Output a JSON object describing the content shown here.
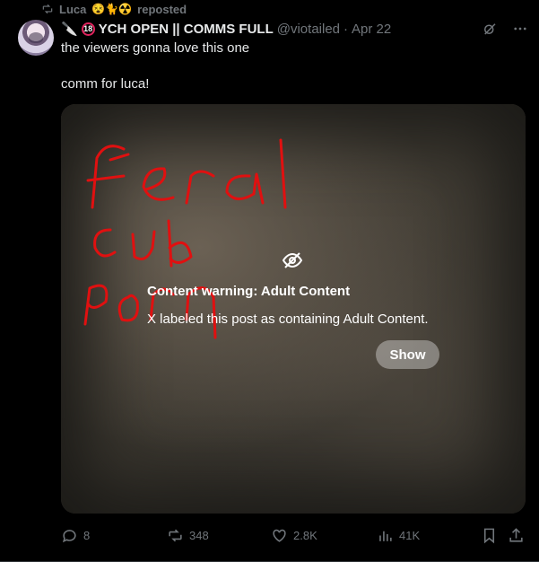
{
  "repost": {
    "icon": "repost-icon",
    "user": "Luca",
    "emojis": "😵🐈☢️",
    "label": "reposted"
  },
  "post": {
    "display_name_prefix": "🔪",
    "badge": "18",
    "display_name": "YCH OPEN || COMMS FULL",
    "handle": "@viotailed",
    "separator": "·",
    "date": "Apr 22",
    "lines": [
      "the viewers gonna love this one",
      "comm for luca!"
    ]
  },
  "media": {
    "content_warning": {
      "icon": "eye-off-icon",
      "title": "Content warning: Adult Content",
      "description": "X labeled this post as containing Adult Content.",
      "button": "Show"
    },
    "scribble_words": [
      "feral",
      "cub",
      "porn"
    ],
    "scribble_color": "#e01010"
  },
  "actions": {
    "replies": "8",
    "reposts": "348",
    "likes": "2.8K",
    "views": "41K"
  },
  "colors": {
    "background": "#000000",
    "text": "#e7e9ea",
    "muted": "#71767b",
    "divider": "#2f3336"
  }
}
